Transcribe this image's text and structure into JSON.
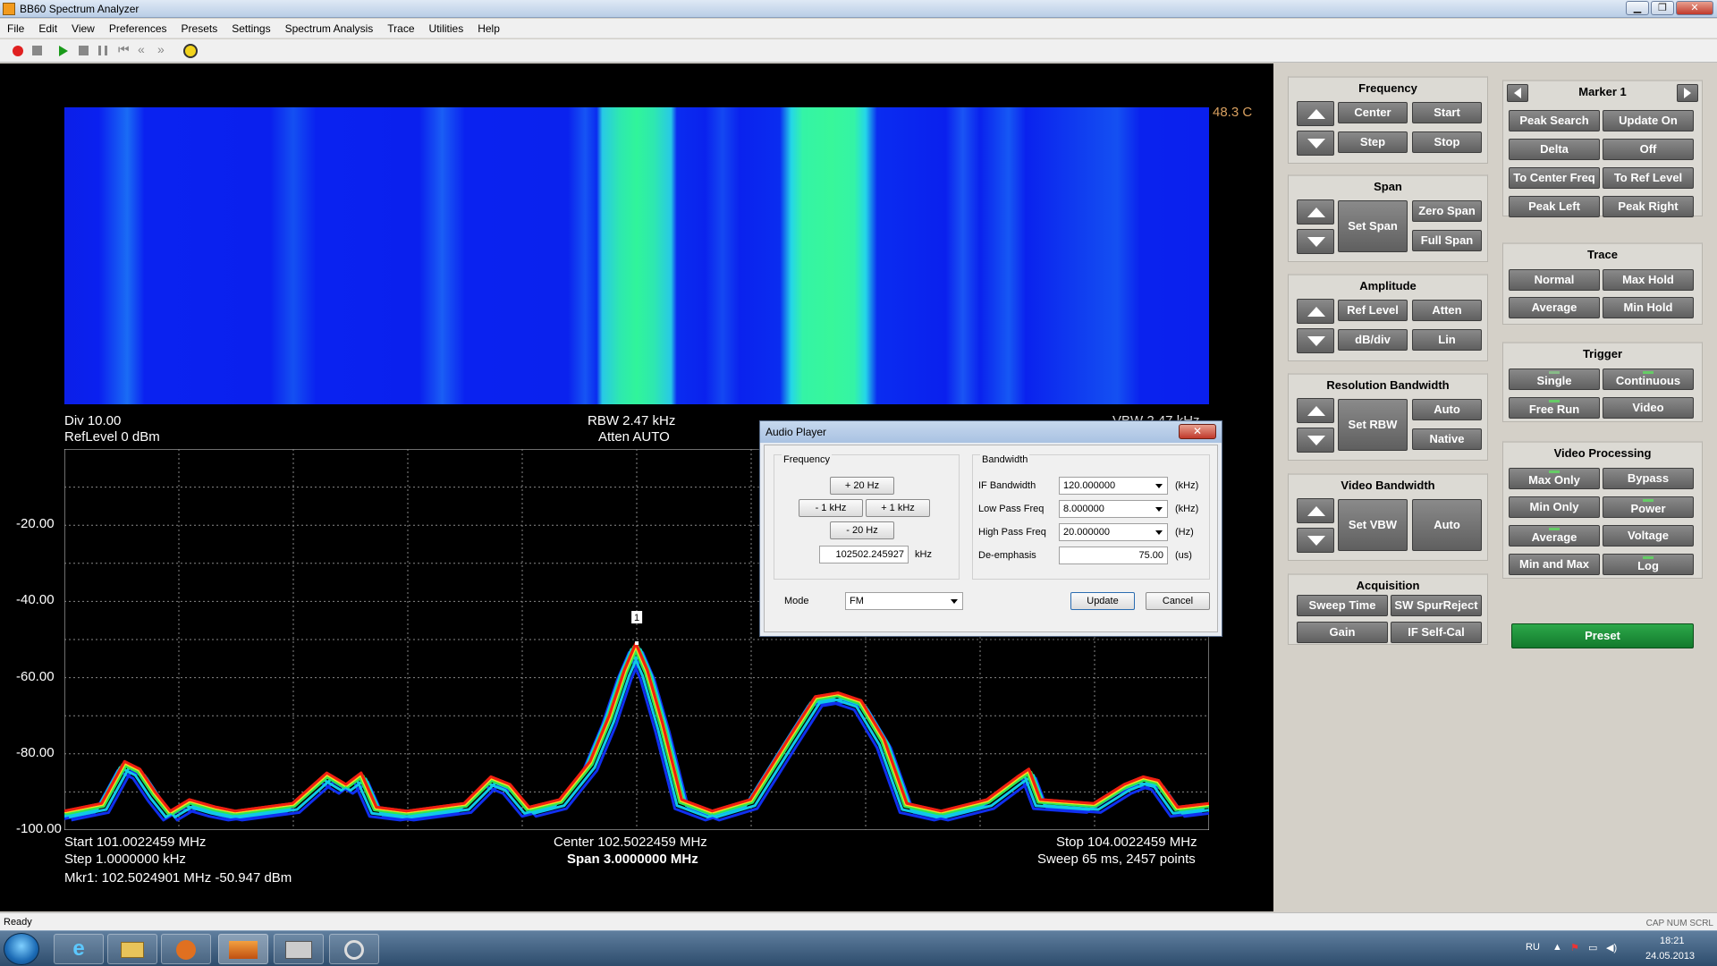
{
  "window": {
    "title": "BB60 Spectrum Analyzer",
    "minimize": "▁",
    "maximize": "❐",
    "close": "✕"
  },
  "menu": [
    "File",
    "Edit",
    "View",
    "Preferences",
    "Presets",
    "Settings",
    "Spectrum Analysis",
    "Trace",
    "Utilities",
    "Help"
  ],
  "toolbar_icons": [
    "record-icon",
    "stop-icon",
    "play-icon",
    "stop-icon",
    "pause-icon",
    "rewind-icon",
    "step-back-icon",
    "step-forward-icon",
    "sweep-icon"
  ],
  "display": {
    "temperature": "48.3 C",
    "div": "Div 10.00",
    "ref_level": "RefLevel 0 dBm",
    "rbw": "RBW 2.47 kHz",
    "atten": "Atten AUTO",
    "vbw": "VBW 2.47 kHz",
    "start": "Start 101.0022459 MHz",
    "step": "Step 1.0000000 kHz",
    "marker": "Mkr1: 102.5024901 MHz -50.947 dBm",
    "center": "Center 102.5022459 MHz",
    "span": "Span 3.0000000 MHz",
    "stop": "Stop 104.0022459 MHz",
    "sweep": "Sweep 65 ms, 2457 points",
    "marker_label": "1"
  },
  "chart_data": {
    "type": "line",
    "ylim": [
      -100,
      0
    ],
    "yticks": [
      "-20.00",
      "-40.00",
      "-60.00",
      "-80.00",
      "-100.00"
    ],
    "ytick_values": [
      -20,
      -40,
      -60,
      -80,
      -100
    ],
    "xlim": [
      101.0022459,
      104.0022459
    ],
    "series": [
      {
        "x": [
          101.0022,
          101.1,
          101.16,
          101.2,
          101.24,
          101.28,
          101.33,
          101.4,
          101.45,
          101.6,
          101.69,
          101.74,
          101.78,
          101.82,
          101.9,
          102.05,
          102.12,
          102.17,
          102.22,
          102.3,
          102.38,
          102.43,
          102.47,
          102.5,
          102.53,
          102.57,
          102.62,
          102.7,
          102.8,
          102.9,
          102.97,
          103.03,
          103.09,
          103.15,
          103.21,
          103.3,
          103.42,
          103.5,
          103.53,
          103.56,
          103.7,
          103.78,
          103.83,
          103.87,
          103.92,
          104.0022
        ],
        "y": [
          -95,
          -93,
          -82,
          -84,
          -90,
          -95,
          -92,
          -94,
          -95,
          -93,
          -85,
          -88,
          -85,
          -94,
          -95,
          -93,
          -86,
          -88,
          -94,
          -92,
          -82,
          -70,
          -58,
          -51,
          -58,
          -72,
          -92,
          -95,
          -92,
          -76,
          -65,
          -64,
          -66,
          -76,
          -93,
          -95,
          -92,
          -86,
          -84,
          -92,
          -93,
          -88,
          -86,
          -87,
          -94,
          -93
        ]
      }
    ]
  },
  "panel": {
    "frequency": {
      "title": "Frequency",
      "center": "Center",
      "start": "Start",
      "step": "Step",
      "stop": "Stop"
    },
    "span": {
      "title": "Span",
      "set_span": "Set Span",
      "zero_span": "Zero Span",
      "full_span": "Full Span"
    },
    "amplitude": {
      "title": "Amplitude",
      "ref_level": "Ref Level",
      "atten": "Atten",
      "db_div": "dB/div",
      "lin": "Lin"
    },
    "rbw": {
      "title": "Resolution Bandwidth",
      "set_rbw": "Set RBW",
      "auto": "Auto",
      "native": "Native"
    },
    "vbw": {
      "title": "Video Bandwidth",
      "set_vbw": "Set VBW",
      "auto": "Auto"
    },
    "acquisition": {
      "title": "Acquisition",
      "sweep_time": "Sweep Time",
      "sw_spur": "SW SpurReject",
      "gain": "Gain",
      "if_selfcal": "IF Self-Cal"
    },
    "marker": {
      "title": "Marker 1",
      "peak_search": "Peak Search",
      "update_on": "Update On",
      "delta": "Delta",
      "off": "Off",
      "to_center": "To Center Freq",
      "to_ref": "To Ref Level",
      "peak_left": "Peak Left",
      "peak_right": "Peak Right"
    },
    "trace": {
      "title": "Trace",
      "normal": "Normal",
      "max_hold": "Max Hold",
      "average": "Average",
      "min_hold": "Min Hold"
    },
    "trigger": {
      "title": "Trigger",
      "single": "Single",
      "continuous": "Continuous",
      "free_run": "Free Run",
      "video": "Video"
    },
    "video_processing": {
      "title": "Video Processing",
      "max_only": "Max Only",
      "bypass": "Bypass",
      "min_only": "Min Only",
      "power": "Power",
      "average": "Average",
      "voltage": "Voltage",
      "min_and_max": "Min and Max",
      "log": "Log"
    },
    "preset": "Preset"
  },
  "dialog": {
    "title": "Audio Player",
    "close": "✕",
    "frequency_group": "Frequency",
    "plus_20hz": "+ 20 Hz",
    "minus_1khz": "- 1 kHz",
    "plus_1khz": "+ 1 kHz",
    "minus_20hz": "- 20 Hz",
    "freq_value": "102502.245927",
    "freq_unit": "kHz",
    "bandwidth_group": "Bandwidth",
    "if_bw_label": "IF Bandwidth",
    "if_bw_value": "120.000000",
    "if_bw_unit": "(kHz)",
    "lpf_label": "Low Pass Freq",
    "lpf_value": "8.000000",
    "lpf_unit": "(kHz)",
    "hpf_label": "High Pass Freq",
    "hpf_value": "20.000000",
    "hpf_unit": "(Hz)",
    "deemph_label": "De-emphasis",
    "deemph_value": "75.00",
    "deemph_unit": "(us)",
    "mode_label": "Mode",
    "mode_value": "FM",
    "update": "Update",
    "cancel": "Cancel"
  },
  "status": {
    "left": "Ready",
    "right": "CAP  NUM  SCRL"
  },
  "taskbar": {
    "lang": "RU",
    "time": "18:21",
    "date": "24.05.2013"
  }
}
